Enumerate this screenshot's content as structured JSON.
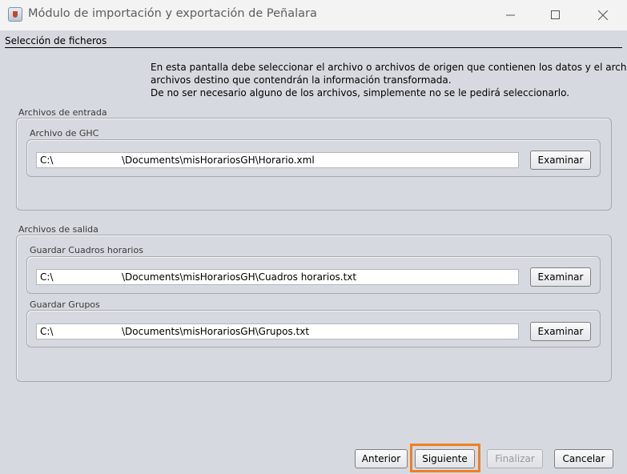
{
  "window": {
    "title": "Módulo de importación y exportación de Peñalara"
  },
  "section": {
    "header": "Selección de ficheros"
  },
  "intro": {
    "lines": [
      "En esta pantalla debe seleccionar el archivo o archivos de origen que contienen los datos y el archivo o",
      "archivos destino que contendrán la información transformada.",
      "De no ser necesario alguno de los archivos, simplemente no se le pedirá seleccionarlo."
    ]
  },
  "input_group": {
    "title": "Archivos de entrada",
    "ghc": {
      "label": "Archivo de GHC",
      "drive": "C:\\",
      "path": "\\Documents\\misHorariosGH\\Horario.xml",
      "browse_label": "Examinar"
    }
  },
  "output_group": {
    "title": "Archivos de salida",
    "cuadros": {
      "label": "Guardar Cuadros horarios",
      "drive": "C:\\",
      "path": "\\Documents\\misHorariosGH\\Cuadros horarios.txt",
      "browse_label": "Examinar"
    },
    "grupos": {
      "label": "Guardar Grupos",
      "drive": "C:\\",
      "path": "\\Documents\\misHorariosGH\\Grupos.txt",
      "browse_label": "Examinar"
    }
  },
  "footer": {
    "anterior": "Anterior",
    "siguiente": "Siguiente",
    "finalizar": "Finalizar",
    "cancelar": "Cancelar"
  },
  "icons": {
    "app": "java-coffee-cup-icon",
    "minimize": "minimize-icon",
    "maximize": "maximize-icon",
    "close": "close-icon"
  },
  "colors": {
    "highlight": "#f07f22",
    "background": "#d6d9df"
  }
}
